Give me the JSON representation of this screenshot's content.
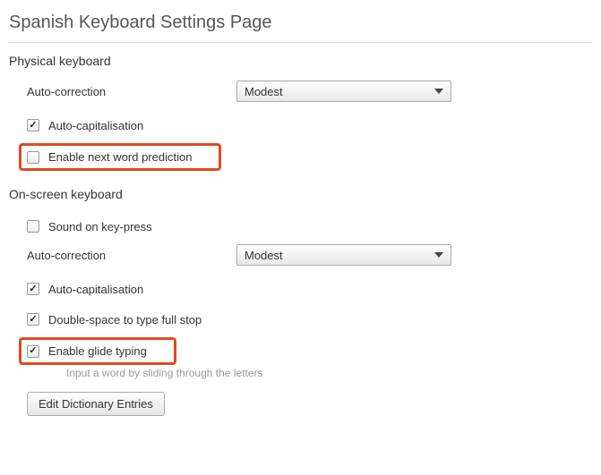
{
  "page_title": "Spanish Keyboard Settings Page",
  "physical": {
    "title": "Physical keyboard",
    "auto_correction_label": "Auto-correction",
    "auto_correction_value": "Modest",
    "auto_capitalisation": {
      "label": "Auto-capitalisation",
      "checked": true
    },
    "next_word_prediction": {
      "label": "Enable next word prediction",
      "checked": false
    }
  },
  "onscreen": {
    "title": "On-screen keyboard",
    "sound_on_keypress": {
      "label": "Sound on key-press",
      "checked": false
    },
    "auto_correction_label": "Auto-correction",
    "auto_correction_value": "Modest",
    "auto_capitalisation": {
      "label": "Auto-capitalisation",
      "checked": true
    },
    "double_space": {
      "label": "Double-space to type full stop",
      "checked": true
    },
    "glide_typing": {
      "label": "Enable glide typing",
      "checked": true
    },
    "glide_hint": "Input a word by sliding through the letters",
    "edit_dictionary": "Edit Dictionary Entries"
  },
  "highlight_color": "#e04a1f"
}
